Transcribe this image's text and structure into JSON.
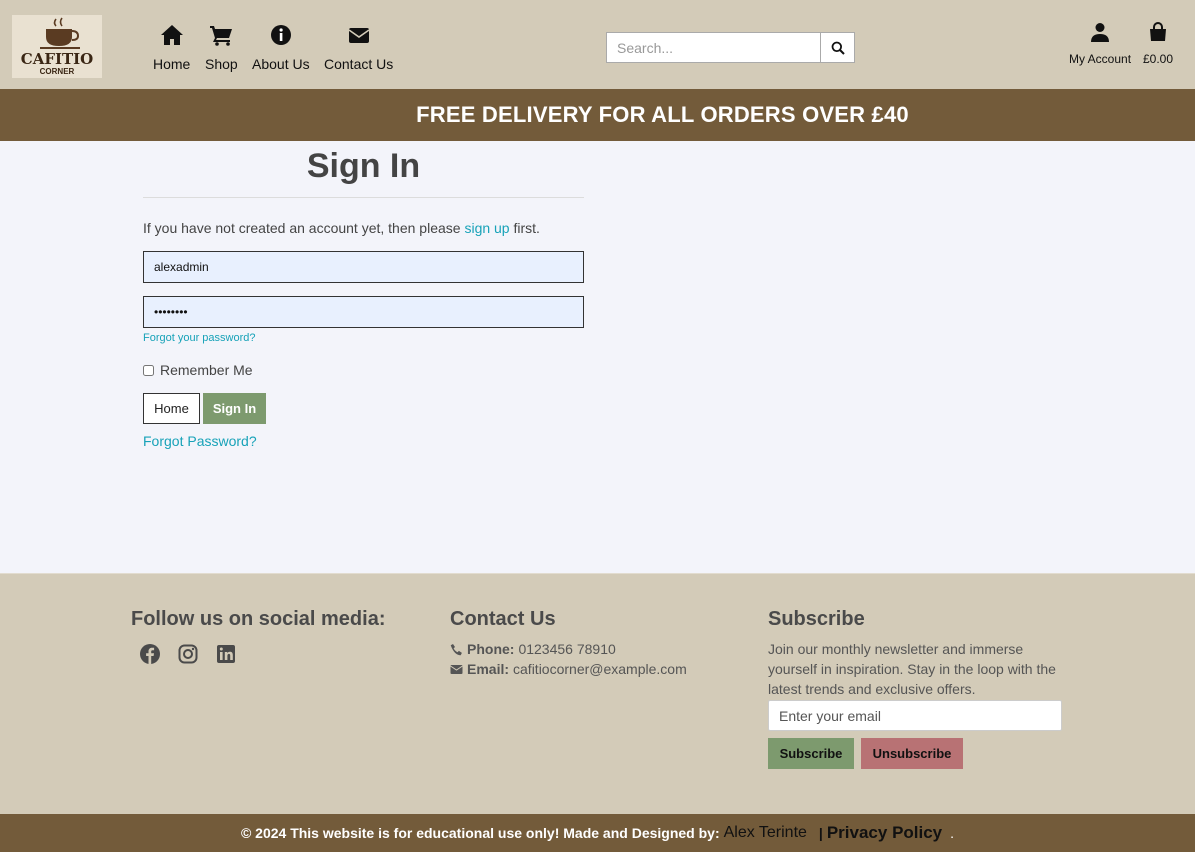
{
  "logo": {
    "line1": "CAFITIO",
    "line2": "CORNER"
  },
  "nav": [
    {
      "label": "Home",
      "icon": "home-icon"
    },
    {
      "label": "Shop",
      "icon": "cart-icon"
    },
    {
      "label": "About Us",
      "icon": "info-icon"
    },
    {
      "label": "Contact Us",
      "icon": "envelope-icon"
    }
  ],
  "search": {
    "placeholder": "Search...",
    "value": ""
  },
  "account": {
    "label": "My Account",
    "icon": "user-icon"
  },
  "bag": {
    "total": "£0.00",
    "icon": "shopping-bag-icon"
  },
  "banner": {
    "text": "FREE DELIVERY FOR ALL ORDERS OVER £40"
  },
  "signin": {
    "title": "Sign In",
    "intro_before": "If you have not created an account yet, then please ",
    "intro_link": "sign up",
    "intro_after": " first.",
    "username_value": "alexadmin",
    "password_value": "password",
    "forgot_small": "Forgot your password?",
    "remember_label": "Remember Me",
    "home_button": "Home",
    "signin_button": "Sign In",
    "forgot_big": "Forgot Password?"
  },
  "footer": {
    "social_heading": "Follow us on social media:",
    "socials": [
      "facebook-icon",
      "instagram-icon",
      "linkedin-icon"
    ],
    "contact_heading": "Contact Us",
    "phone_label": "Phone:",
    "phone_value": "0123456 78910",
    "email_label": "Email:",
    "email_value": "cafitiocorner@example.com",
    "subscribe_heading": "Subscribe",
    "subscribe_text": "Join our monthly newsletter and immerse yourself in inspiration. Stay in the loop with the latest trends and exclusive offers.",
    "email_placeholder": "Enter your email",
    "subscribe_button": "Subscribe",
    "unsubscribe_button": "Unsubscribe"
  },
  "bottom_bar": {
    "copyright": "© 2024 This website is for educational use only! Made and Designed by:",
    "author": "Alex Terinte",
    "separator": "|",
    "privacy": "Privacy Policy",
    "trailing": "."
  },
  "colors": {
    "header_bg": "#d3cbb8",
    "banner_bg": "#735b3a",
    "accent_green": "#7d9a6e",
    "accent_red": "#b87274",
    "link": "#17a2b8"
  }
}
